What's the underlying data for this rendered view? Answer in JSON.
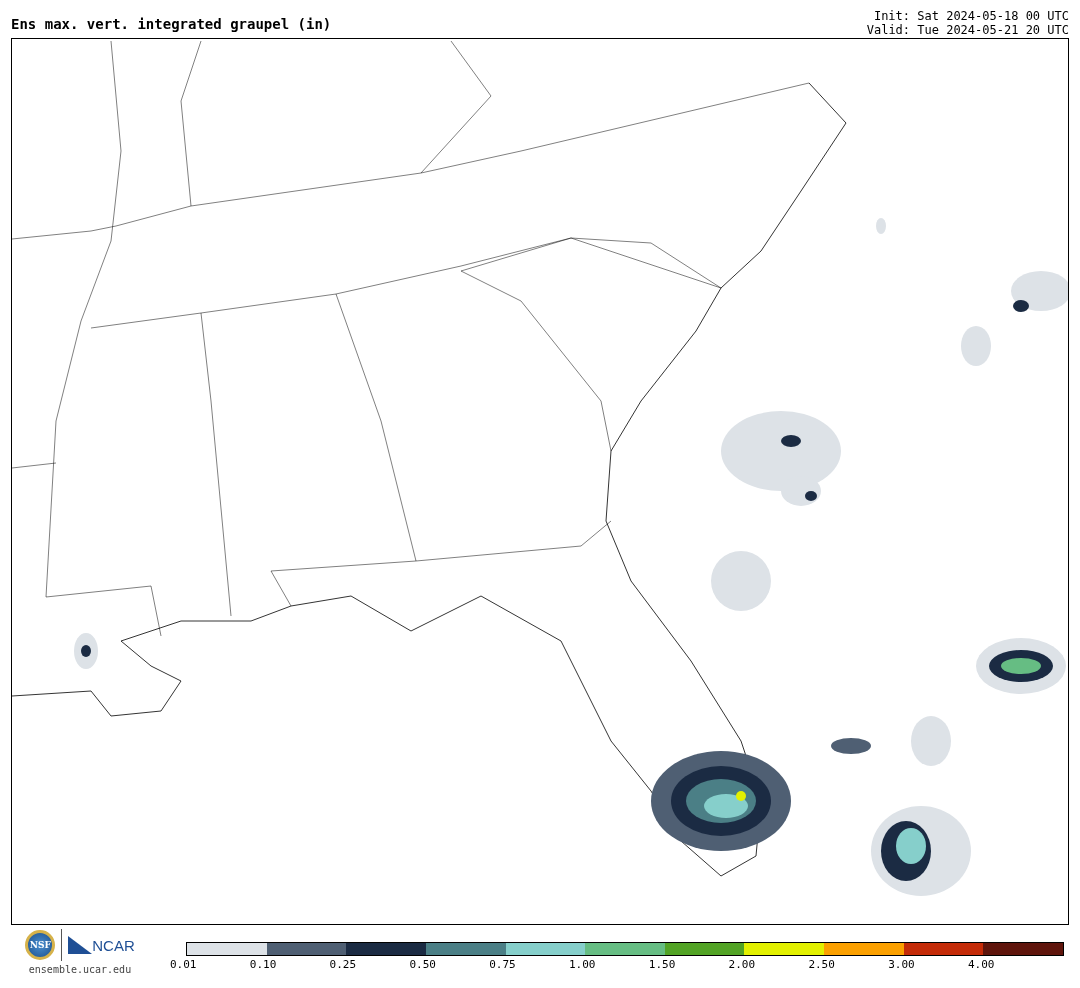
{
  "title": "Ens max. vert. integrated graupel (in)",
  "init": "Init: Sat 2024-05-18 00 UTC",
  "valid": "Valid: Tue 2024-05-21 20 UTC",
  "logo": {
    "nsf": "NSF",
    "ncar": "NCAR",
    "site": "ensemble.ucar.edu"
  },
  "legend": [
    {
      "label": "0.01",
      "color": "#dde2e7"
    },
    {
      "label": "0.10",
      "color": "#4f5f73"
    },
    {
      "label": "0.25",
      "color": "#1b2b43"
    },
    {
      "label": "0.50",
      "color": "#4b7f86"
    },
    {
      "label": "0.75",
      "color": "#86cfcb"
    },
    {
      "label": "1.00",
      "color": "#66bd83"
    },
    {
      "label": "1.50",
      "color": "#52a325"
    },
    {
      "label": "2.00",
      "color": "#e2f000"
    },
    {
      "label": "2.50",
      "color": "#fba000"
    },
    {
      "label": "3.00",
      "color": "#c42b08"
    },
    {
      "label": "4.00",
      "color": "#5f150c"
    }
  ]
}
